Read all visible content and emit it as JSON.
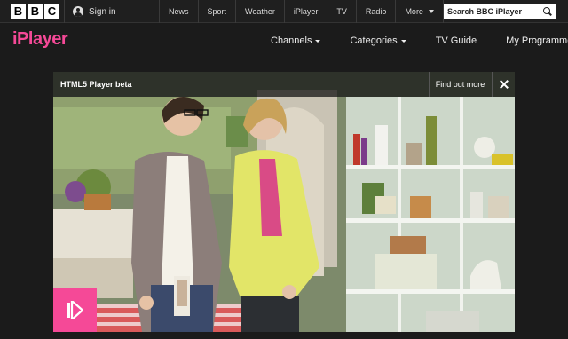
{
  "bbc_bar": {
    "logo_letters": [
      "B",
      "B",
      "C"
    ],
    "sign_in": "Sign in",
    "nav": [
      "News",
      "Sport",
      "Weather",
      "iPlayer",
      "TV",
      "Radio"
    ],
    "more": "More",
    "search_placeholder": "Search BBC iPlayer"
  },
  "iplayer_header": {
    "logo": "iPlayer",
    "logo_color": "#f54997",
    "nav": [
      "Channels",
      "Categories",
      "TV Guide",
      "My Programmes"
    ]
  },
  "player": {
    "banner_title": "HTML5 Player beta",
    "find_out_more": "Find out more",
    "accent": "#f54997"
  }
}
